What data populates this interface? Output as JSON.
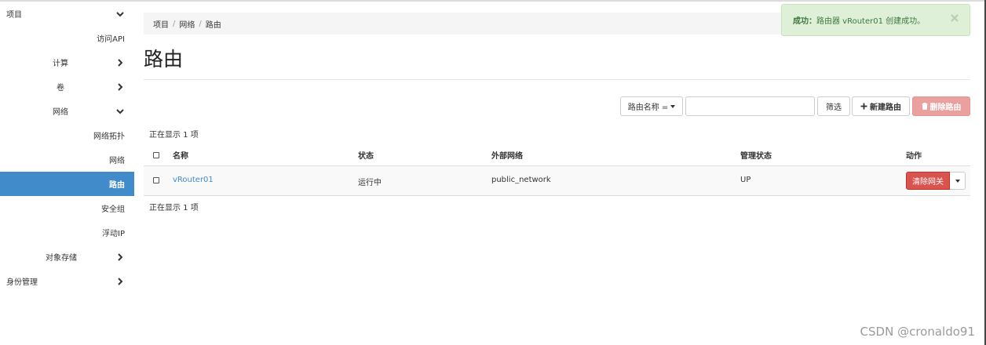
{
  "sidebar": {
    "items": [
      {
        "label": "项目",
        "chevron": "down"
      },
      {
        "label": "访问API"
      },
      {
        "label": "计算",
        "chevron": "right"
      },
      {
        "label": "卷",
        "chevron": "right"
      },
      {
        "label": "网络",
        "chevron": "down"
      },
      {
        "label": "网络拓扑"
      },
      {
        "label": "网络"
      },
      {
        "label": "路由",
        "active": true
      },
      {
        "label": "安全组"
      },
      {
        "label": "浮动IP"
      },
      {
        "label": "对象存储",
        "chevron": "right"
      },
      {
        "label": "身份管理",
        "chevron": "right"
      }
    ]
  },
  "breadcrumb": [
    "项目",
    "网络",
    "路由"
  ],
  "page": {
    "title": "路由"
  },
  "toolbar": {
    "filter_select": "路由名称 =",
    "filter_input_value": "",
    "filter_button": "筛选",
    "create_button": "新建路由",
    "delete_button": "删除路由"
  },
  "table": {
    "count_top": "正在显示 1 项",
    "count_bottom": "正在显示 1 项",
    "headers": {
      "name": "名称",
      "status": "状态",
      "external_network": "外部网络",
      "admin_state": "管理状态",
      "actions": "动作"
    },
    "rows": [
      {
        "name": "vRouter01",
        "status": "运行中",
        "external_network": "public_network",
        "admin_state": "UP",
        "action": "清除网关"
      }
    ]
  },
  "alert": {
    "prefix": "成功：",
    "message": "路由器 vRouter01 创建成功。"
  },
  "watermark": "CSDN @cronaldo91",
  "colors": {
    "accent": "#428bca",
    "danger": "#d9534f",
    "success_bg": "#dff0d8",
    "success_text": "#3c763d"
  }
}
